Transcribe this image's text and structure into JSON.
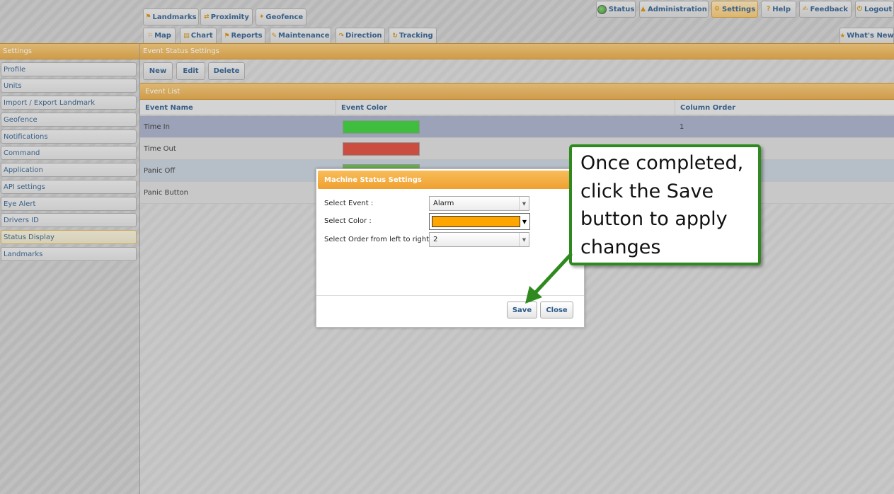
{
  "top_tabs_row1": [
    {
      "label": "Landmarks",
      "icon": "landmark-icon"
    },
    {
      "label": "Proximity",
      "icon": "proximity-icon"
    },
    {
      "label": "Geofence",
      "icon": "geofence-icon"
    }
  ],
  "top_tabs_row2": [
    {
      "label": "Map",
      "icon": "map-icon"
    },
    {
      "label": "Chart",
      "icon": "chart-icon"
    },
    {
      "label": "Reports",
      "icon": "reports-icon"
    },
    {
      "label": "Maintenance",
      "icon": "maintenance-icon"
    },
    {
      "label": "Direction",
      "icon": "direction-icon"
    },
    {
      "label": "Tracking",
      "icon": "tracking-icon"
    }
  ],
  "top_right": {
    "status": "Status",
    "administration": "Administration",
    "settings": "Settings",
    "help": "Help",
    "feedback": "Feedback",
    "logout": "Logout",
    "whats_new": "What's New"
  },
  "sidebar": {
    "title": "Settings",
    "items": [
      {
        "label": "Profile"
      },
      {
        "label": "Units"
      },
      {
        "label": "Import / Export Landmark"
      },
      {
        "label": "Geofence"
      },
      {
        "label": "Notifications"
      },
      {
        "label": "Command"
      },
      {
        "label": "Application"
      },
      {
        "label": "API settings"
      },
      {
        "label": "Eye Alert"
      },
      {
        "label": "Drivers ID"
      },
      {
        "label": "Status Display"
      },
      {
        "label": "Landmarks"
      }
    ],
    "active_index": 10
  },
  "main": {
    "title": "Event Status Settings",
    "toolbar": {
      "new": "New",
      "edit": "Edit",
      "delete": "Delete"
    },
    "list_title": "Event List",
    "columns": [
      "Event Name",
      "Event Color",
      "Column Order"
    ],
    "rows": [
      {
        "name": "Time In",
        "color": "#33cc33",
        "order": "1"
      },
      {
        "name": "Time Out",
        "color": "#dd4433",
        "order": ""
      },
      {
        "name": "Panic Off",
        "color": "#66bb44",
        "order": ""
      },
      {
        "name": "Panic Button",
        "color": "",
        "order": ""
      }
    ]
  },
  "modal": {
    "title": "Machine Status Settings",
    "event_label": "Select Event :",
    "event_value": "Alarm",
    "color_label": "Select Color :",
    "color_value": "#ffa500",
    "order_label": "Select Order from left to right :",
    "order_value": "2",
    "save": "Save",
    "close": "Close"
  },
  "callout": {
    "text": "Once completed, click the Save button to apply changes"
  },
  "colors": {
    "accent_orange": "#e3a43f",
    "callout_green": "#2e8a1e",
    "link_blue": "#2a5a8a"
  }
}
